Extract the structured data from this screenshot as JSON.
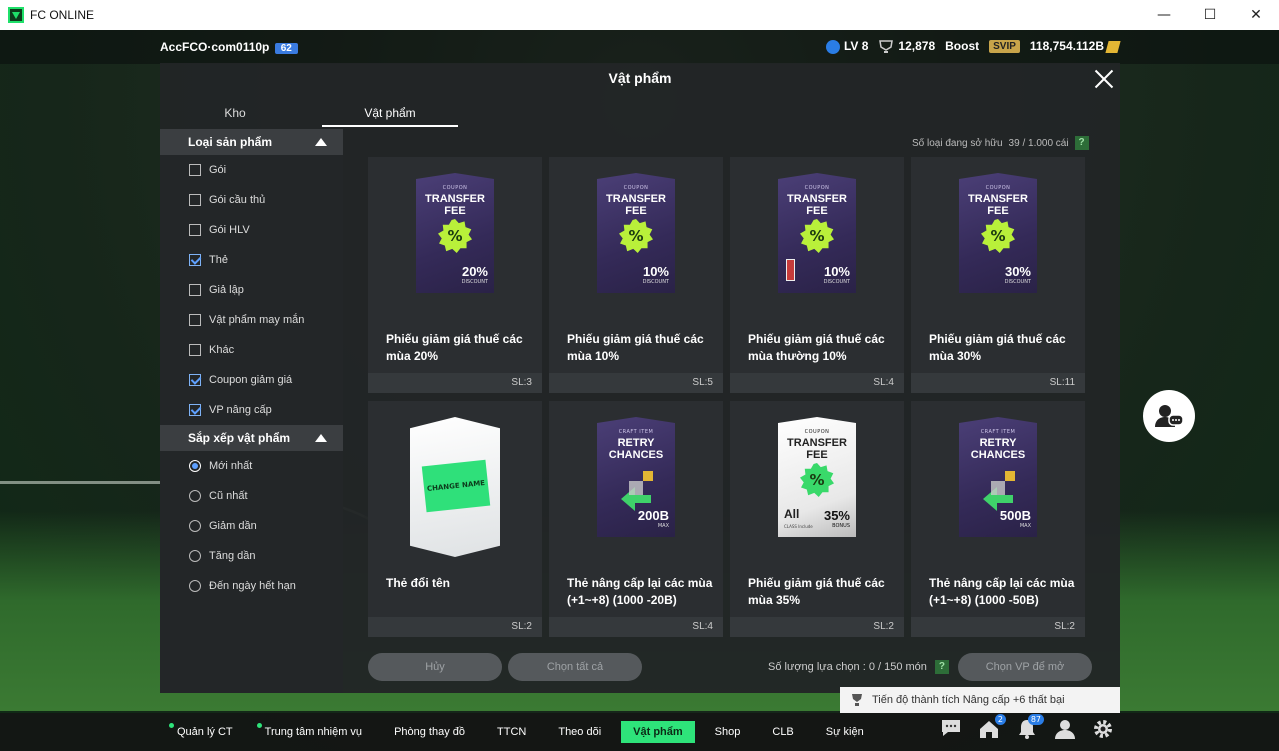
{
  "window": {
    "title": "FC ONLINE",
    "minimize": "—",
    "maximize": "☐",
    "close": "✕"
  },
  "hud": {
    "account": "AccFCO·com0110p",
    "account_badge": "62",
    "level": "LV 8",
    "trophies": "12,878",
    "boost_label": "Boost",
    "svip": "SVIP",
    "bp": "118,754.112B"
  },
  "modal": {
    "title": "Vật phẩm",
    "tabs": [
      {
        "label": "Kho"
      },
      {
        "label": "Vật phẩm"
      }
    ],
    "owned_label": "Số loại đang sở hữu",
    "owned_value": "39 / 1.000 cái",
    "help": "?"
  },
  "filters": {
    "type_header": "Loại sản phẩm",
    "types": [
      {
        "label": "Gói",
        "checked": false
      },
      {
        "label": "Gói cầu thủ",
        "checked": false
      },
      {
        "label": "Gói HLV",
        "checked": false
      },
      {
        "label": "Thẻ",
        "checked": true
      },
      {
        "label": "Giả lập",
        "checked": false
      },
      {
        "label": "Vật phẩm may mắn",
        "checked": false
      },
      {
        "label": "Khác",
        "checked": false
      },
      {
        "label": "Coupon giảm giá",
        "checked": true
      },
      {
        "label": "VP nâng cấp",
        "checked": true
      }
    ],
    "sort_header": "Sắp xếp vật phẩm",
    "sorts": [
      {
        "label": "Mới nhất",
        "selected": true
      },
      {
        "label": "Cũ nhất",
        "selected": false
      },
      {
        "label": "Giảm dần",
        "selected": false
      },
      {
        "label": "Tăng dần",
        "selected": false
      },
      {
        "label": "Đến ngày hết hạn",
        "selected": false
      }
    ]
  },
  "items": [
    {
      "name": "Phiếu giảm giá thuế các mùa 20%",
      "qty": "SL:3",
      "art": {
        "small": "COUPON",
        "big": "TRANSFER FEE",
        "badge": "%",
        "value": "20%",
        "sub": "DISCOUNT"
      }
    },
    {
      "name": "Phiếu giảm giá thuế các mùa 10%",
      "qty": "SL:5",
      "art": {
        "small": "COUPON",
        "big": "TRANSFER FEE",
        "badge": "%",
        "value": "10%",
        "sub": "DISCOUNT"
      }
    },
    {
      "name": "Phiếu giảm giá thuế các mùa thường 10%",
      "qty": "SL:4",
      "art": {
        "small": "COUPON",
        "big": "TRANSFER FEE",
        "badge": "%",
        "value": "10%",
        "sub": "DISCOUNT"
      }
    },
    {
      "name": "Phiếu giảm giá thuế các mùa 30%",
      "qty": "SL:11",
      "art": {
        "small": "COUPON",
        "big": "TRANSFER FEE",
        "badge": "%",
        "value": "30%",
        "sub": "DISCOUNT"
      }
    },
    {
      "name": "Thẻ đổi tên",
      "qty": "SL:2",
      "art": {
        "ticket": "CHANGE NAME"
      }
    },
    {
      "name": "Thẻ nâng cấp lại các mùa (+1~+8) (1000 -20B)",
      "qty": "SL:4",
      "art": {
        "small": "CRAFT ITEM",
        "big": "RETRY CHANCES",
        "value": "200B",
        "sub": "MAX"
      }
    },
    {
      "name": "Phiếu giảm giá thuế các mùa 35%",
      "qty": "SL:2",
      "art": {
        "small": "COUPON",
        "big": "TRANSFER FEE",
        "badge": "%",
        "value": "35%",
        "sub": "BONUS",
        "all": "All",
        "all_sub": "CLASS Include"
      }
    },
    {
      "name": "Thẻ nâng cấp lại các mùa (+1~+8) (1000 -50B)",
      "qty": "SL:2",
      "art": {
        "small": "CRAFT ITEM",
        "big": "RETRY CHANCES",
        "value": "500B",
        "sub": "MAX"
      }
    }
  ],
  "footer": {
    "cancel": "Hủy",
    "select_all": "Chọn tất cả",
    "selected_label": "Số lượng lựa chọn : 0 / 150 món",
    "help": "?",
    "choose": "Chọn VP để mở"
  },
  "achievement": "Tiến độ thành tích Nâng cấp +6 thất bại",
  "nav": [
    {
      "label": "Quản lý CT"
    },
    {
      "label": "Trung tâm nhiệm vụ"
    },
    {
      "label": "Phòng thay đồ"
    },
    {
      "label": "TTCN"
    },
    {
      "label": "Theo dõi"
    },
    {
      "label": "Vật phẩm"
    },
    {
      "label": "Shop"
    },
    {
      "label": "CLB"
    },
    {
      "label": "Sự kiện"
    }
  ],
  "nav_badges": {
    "home": "2",
    "bell": "87"
  },
  "colors": {
    "accent": "#2ee37a",
    "panel": "#232628",
    "badge": "#b9f03a"
  }
}
